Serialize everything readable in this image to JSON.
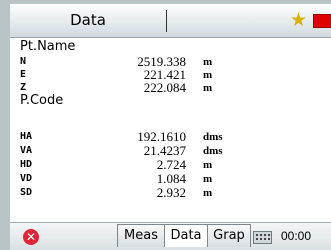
{
  "titlebar": {
    "title": "Data"
  },
  "sections": {
    "pt_name": "Pt.Name",
    "p_code": "P.Code"
  },
  "coords": [
    {
      "label": "N",
      "value": "2519.338",
      "unit": "m"
    },
    {
      "label": "E",
      "value": "221.421",
      "unit": "m"
    },
    {
      "label": "Z",
      "value": "222.084",
      "unit": "m"
    }
  ],
  "measurements": [
    {
      "label": "HA",
      "value": "192.1610",
      "unit": "dms"
    },
    {
      "label": "VA",
      "value": "21.4237",
      "unit": "dms"
    },
    {
      "label": "HD",
      "value": "2.724",
      "unit": "m"
    },
    {
      "label": "VD",
      "value": "1.084",
      "unit": "m"
    },
    {
      "label": "SD",
      "value": "2.932",
      "unit": "m"
    }
  ],
  "bottombar": {
    "tabs": [
      "Meas",
      "Data",
      "Grap"
    ],
    "active_tab": "Data",
    "time": "00:00"
  },
  "icons": {
    "star": "star-icon",
    "battery": "battery-icon",
    "close": "close-icon",
    "keyboard": "keyboard-icon"
  },
  "colors": {
    "star": "#d8b000",
    "battery": "#e00000",
    "close": "#e0243a"
  }
}
